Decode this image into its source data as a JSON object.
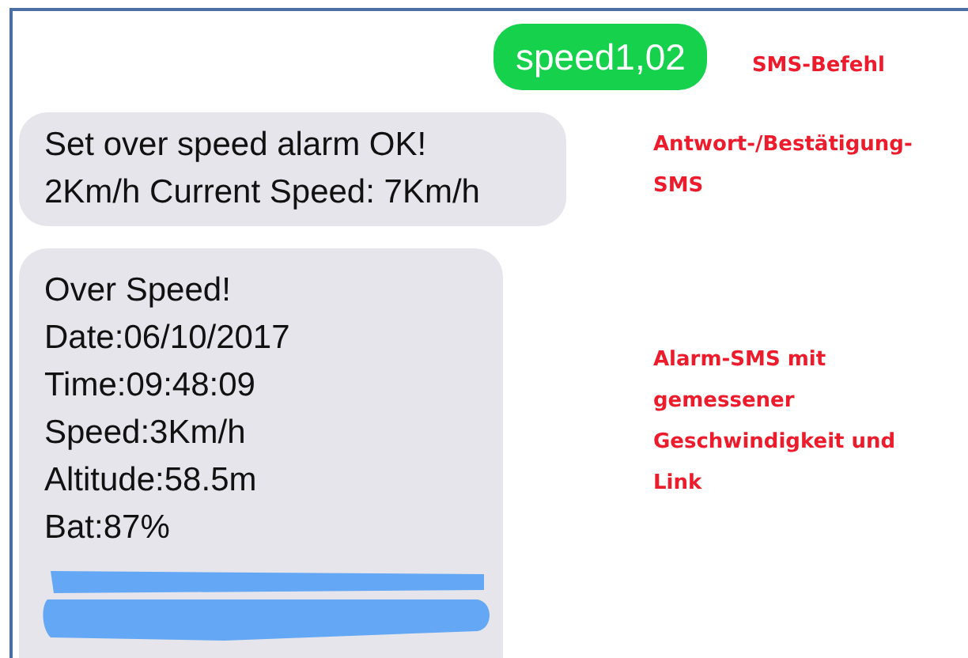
{
  "messages": [
    {
      "kind": "sent",
      "lines": [
        "speed1,02"
      ],
      "note": [
        "SMS-Befehl"
      ],
      "link_redacted": false
    },
    {
      "kind": "received",
      "lines": [
        "Set over speed alarm OK!",
        "2Km/h Current Speed: 7Km/h"
      ],
      "note": [
        "Antwort-/Bestätigung-",
        "SMS"
      ],
      "link_redacted": false
    },
    {
      "kind": "received",
      "lines": [
        "Over Speed!",
        "Date:06/10/2017",
        "Time:09:48:09",
        "Speed:3Km/h",
        "Altitude:58.5m",
        "Bat:87%"
      ],
      "note": [
        "Alarm-SMS mit",
        "gemessener",
        "Geschwindigkeit und",
        "Link"
      ],
      "link_redacted": true
    }
  ]
}
